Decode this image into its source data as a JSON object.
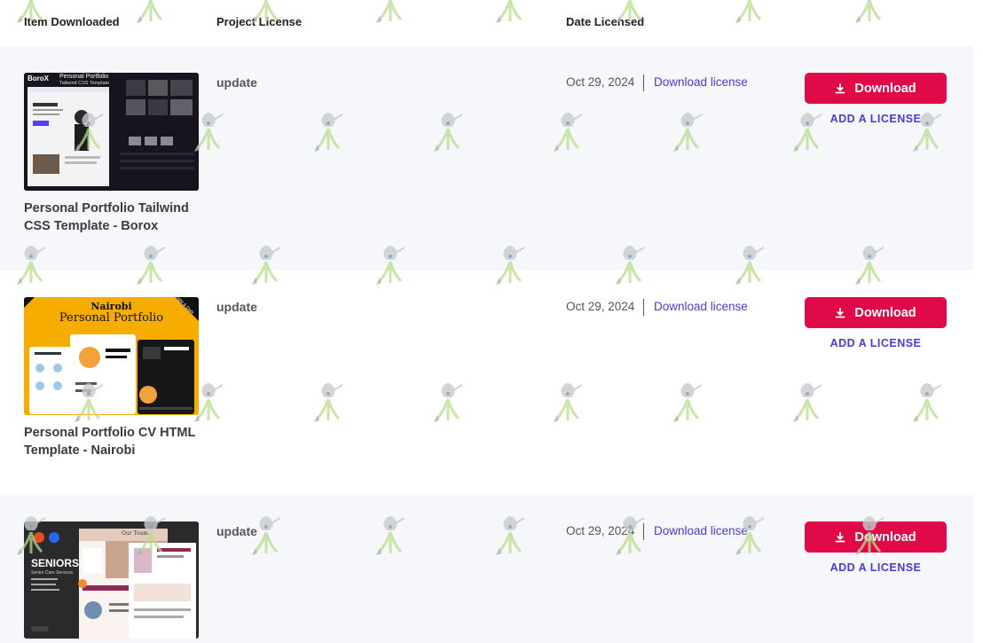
{
  "header": {
    "item_downloaded": "Item Downloaded",
    "project_license": "Project License",
    "date_licensed": "Date Licensed"
  },
  "rows": [
    {
      "thumb": {
        "brand": "BoroX",
        "headline": "Personal Portfolio",
        "sub": "Tailwind CSS Template"
      },
      "title": "Personal Portfolio Tailwind CSS Template - Borox",
      "license": "update",
      "date": "Oct 29, 2024",
      "download_license": "Download license",
      "download_button": "Download",
      "add_license": "ADD A LICENSE"
    },
    {
      "thumb": {
        "brand": "Nairobi",
        "headline": "Personal Portfolio",
        "sub": "Light & Dark"
      },
      "title": "Personal Portfolio CV HTML Template - Nairobi",
      "license": "update",
      "date": "Oct 29, 2024",
      "download_license": "Download license",
      "download_button": "Download",
      "add_license": "ADD A LICENSE"
    },
    {
      "thumb": {
        "brand": "SENIORSY",
        "headline": "Our Team",
        "sub": "Senior Care Services"
      },
      "title": "",
      "license": "update",
      "date": "Oct 29, 2024",
      "download_license": "Download license",
      "download_button": "Download",
      "add_license": "ADD A LICENSE"
    }
  ],
  "colors": {
    "accent_button": "#e00a48",
    "link": "#4b3bd6",
    "row_alt_bg": "#f6f7fb"
  },
  "icons": {
    "download": "download-icon",
    "watermark": "watering-can-sprout-icon"
  }
}
